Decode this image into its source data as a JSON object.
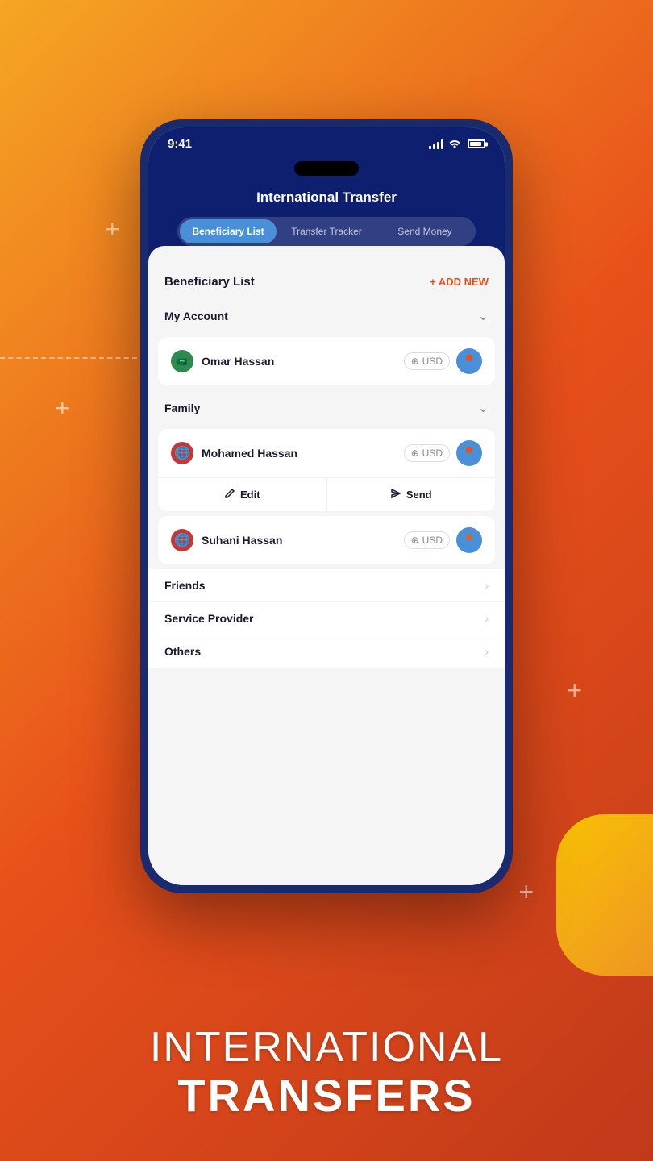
{
  "background": {
    "gradient_start": "#f5a623",
    "gradient_end": "#c0391a"
  },
  "status_bar": {
    "time": "9:41"
  },
  "header": {
    "title": "International Transfer"
  },
  "tabs": [
    {
      "label": "Beneficiary List",
      "active": true
    },
    {
      "label": "Transfer Tracker",
      "active": false
    },
    {
      "label": "Send Money",
      "active": false
    }
  ],
  "content": {
    "page_title": "Beneficiary List",
    "add_new_label": "+ ADD NEW",
    "categories": [
      {
        "name": "My Account",
        "expanded": true,
        "chevron": "down",
        "items": [
          {
            "name": "Omar Hassan",
            "flag_emoji": "🟢",
            "currency": "USD",
            "show_actions": false
          }
        ]
      },
      {
        "name": "Family",
        "expanded": true,
        "chevron": "down",
        "items": [
          {
            "name": "Mohamed Hassan",
            "flag_emoji": "🌐",
            "currency": "USD",
            "show_actions": true,
            "edit_label": "Edit",
            "send_label": "Send"
          },
          {
            "name": "Suhani Hassan",
            "flag_emoji": "🌐",
            "currency": "USD",
            "show_actions": false
          }
        ]
      },
      {
        "name": "Friends",
        "expanded": false,
        "chevron": "right"
      },
      {
        "name": "Service Provider",
        "expanded": false,
        "chevron": "right"
      },
      {
        "name": "Others",
        "expanded": false,
        "chevron": "right"
      }
    ]
  },
  "bottom_headline": {
    "line1": "INTERNATIONAL",
    "line2": "TRANSFERS"
  }
}
